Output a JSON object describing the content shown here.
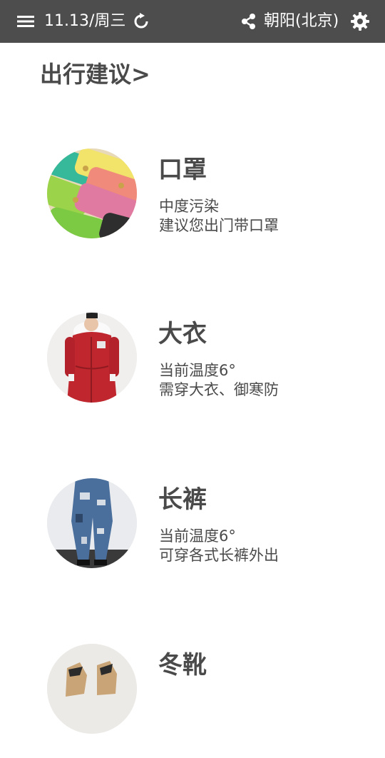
{
  "topbar": {
    "date": "11.13/周三",
    "city": "朝阳(北京)",
    "icons": [
      "menu-icon",
      "refresh-icon",
      "share-icon",
      "settings-icon"
    ],
    "background": "#4d4d4d"
  },
  "section": {
    "title": "出行建议>"
  },
  "items": [
    {
      "name": "口罩",
      "line1": "中度污染",
      "line2": "建议您出门带口罩",
      "image": "masks-photo"
    },
    {
      "name": "大衣",
      "line1": "当前温度6°",
      "line2": "需穿大衣、御寒防",
      "image": "red-coat-photo"
    },
    {
      "name": "长裤",
      "line1": "当前温度6°",
      "line2": "可穿各式长裤外出",
      "image": "jeans-photo"
    },
    {
      "name": "冬靴",
      "line1": "",
      "line2": "",
      "image": "winter-boots-photo"
    }
  ]
}
